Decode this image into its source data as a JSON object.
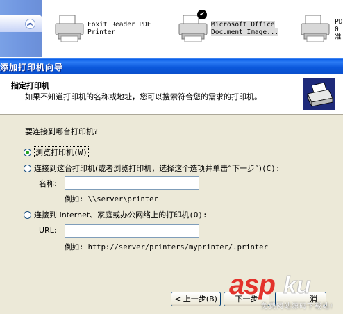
{
  "background": {
    "printers": [
      {
        "name_line1": "Foxit Reader PDF",
        "name_line2": "Printer"
      },
      {
        "name_line1": "Microsoft Office",
        "name_line2": "Document Image..."
      },
      {
        "name_line1": "PD",
        "name_line2": "0",
        "name_line3": "准"
      }
    ]
  },
  "dialog": {
    "title": "添加打印机向导",
    "header": {
      "title": "指定打印机",
      "subtitle": "如果不知道打印机的名称或地址，您可以搜索符合您的需求的打印机。"
    },
    "prompt": "要连接到哪台打印机?",
    "options": [
      {
        "label": "浏览打印机",
        "key": "(W)"
      },
      {
        "label": "连接到这台打印机(或者浏览打印机，选择这个选项并单击“下一步”)",
        "key": "(C):"
      },
      {
        "label": "连接到 Internet、家庭或办公网络上的打印机",
        "key": "(O):"
      }
    ],
    "name_field": {
      "label": "名称:",
      "value": "",
      "example": "例如: \\\\server\\printer"
    },
    "url_field": {
      "label": "URL:",
      "value": "",
      "example": "例如: http://server/printers/myprinter/.printer"
    },
    "buttons": {
      "back": "< 上一步(B)",
      "next": "下一步",
      "cancel": "消"
    }
  },
  "watermark": {
    "brand1": "asp",
    "brand2": "ku",
    "sub": "免费网站源码下载站!"
  }
}
